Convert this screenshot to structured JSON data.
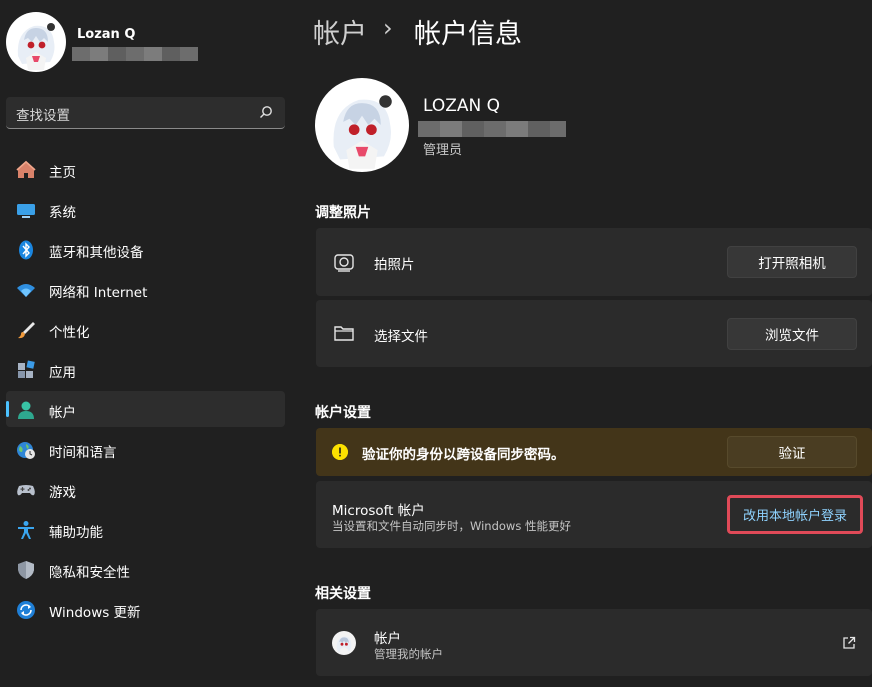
{
  "user": {
    "name": "Lozan Q"
  },
  "search": {
    "placeholder": "查找设置"
  },
  "nav": {
    "items": [
      {
        "label": "主页",
        "icon": "home-icon"
      },
      {
        "label": "系统",
        "icon": "system-icon"
      },
      {
        "label": "蓝牙和其他设备",
        "icon": "bluetooth-icon"
      },
      {
        "label": "网络和 Internet",
        "icon": "wifi-icon"
      },
      {
        "label": "个性化",
        "icon": "brush-icon"
      },
      {
        "label": "应用",
        "icon": "apps-icon"
      },
      {
        "label": "帐户",
        "icon": "account-icon",
        "active": true
      },
      {
        "label": "时间和语言",
        "icon": "globe-clock-icon"
      },
      {
        "label": "游戏",
        "icon": "gamepad-icon"
      },
      {
        "label": "辅助功能",
        "icon": "accessibility-icon"
      },
      {
        "label": "隐私和安全性",
        "icon": "shield-icon"
      },
      {
        "label": "Windows 更新",
        "icon": "update-icon"
      }
    ]
  },
  "breadcrumb": {
    "parent": "帐户",
    "separator": "›",
    "current": "帐户信息"
  },
  "profile": {
    "name": "LOZAN Q",
    "role": "管理员"
  },
  "adjust_photo": {
    "title": "调整照片",
    "take_photo": {
      "label": "拍照片",
      "button": "打开照相机",
      "icon": "camera-icon"
    },
    "choose_file": {
      "label": "选择文件",
      "button": "浏览文件",
      "icon": "folder-icon"
    }
  },
  "account_settings": {
    "title": "帐户设置",
    "warning": {
      "text": "验证你的身份以跨设备同步密码。",
      "button": "验证",
      "icon": "warning-icon"
    },
    "microsoft": {
      "title": "Microsoft 帐户",
      "subtitle": "当设置和文件自动同步时，Windows 性能更好",
      "link": "改用本地帐户登录"
    }
  },
  "related": {
    "title": "相关设置",
    "item": {
      "title": "帐户",
      "subtitle": "管理我的帐户",
      "icon": "external-link-icon"
    }
  },
  "colors": {
    "accent": "#4cc2ff",
    "warning_bg": "#433519",
    "warning_icon": "#fce100",
    "highlight": "#e04a58",
    "link": "#8fd3ff"
  }
}
